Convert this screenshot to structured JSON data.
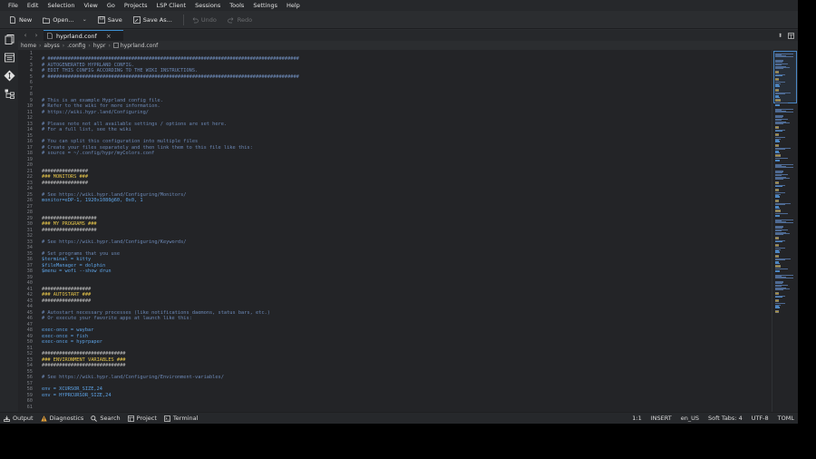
{
  "menu": [
    "File",
    "Edit",
    "Selection",
    "View",
    "Go",
    "Projects",
    "LSP Client",
    "Sessions",
    "Tools",
    "Settings",
    "Help"
  ],
  "toolbar": {
    "new_label": "New",
    "open_label": "Open...",
    "save_label": "Save",
    "save_as_label": "Save As...",
    "undo_label": "Undo",
    "redo_label": "Redo"
  },
  "tab": {
    "label": "hyprland.conf",
    "close": "×"
  },
  "breadcrumb": [
    "home",
    "abyss",
    ".config",
    "hypr",
    "hyprland.conf"
  ],
  "code_lines": [
    {
      "n": "1",
      "t": "",
      "c": "plain"
    },
    {
      "n": "2",
      "t": "# #######################################################################################",
      "c": "cmt"
    },
    {
      "n": "3",
      "t": "# AUTOGENERATED HYPRLAND CONFIG.",
      "c": "cmt"
    },
    {
      "n": "4",
      "t": "# EDIT THIS CONFIG ACCORDING TO THE WIKI INSTRUCTIONS.",
      "c": "cmt"
    },
    {
      "n": "5",
      "t": "# #######################################################################################",
      "c": "cmt"
    },
    {
      "n": "6",
      "t": "",
      "c": "plain"
    },
    {
      "n": "7",
      "t": "",
      "c": "plain"
    },
    {
      "n": "8",
      "t": "",
      "c": "plain"
    },
    {
      "n": "9",
      "t": "# This is an example Hyprland config file.",
      "c": "cmt"
    },
    {
      "n": "10",
      "t": "# Refer to the wiki for more information.",
      "c": "cmt"
    },
    {
      "n": "11",
      "t": "# https://wiki.hypr.land/Configuring/",
      "c": "cmt"
    },
    {
      "n": "12",
      "t": "",
      "c": "plain"
    },
    {
      "n": "13",
      "t": "# Please note not all available settings / options are set here.",
      "c": "cmt"
    },
    {
      "n": "14",
      "t": "# For a full list, see the wiki",
      "c": "cmt"
    },
    {
      "n": "15",
      "t": "",
      "c": "plain"
    },
    {
      "n": "16",
      "t": "# You can split this configuration into multiple files",
      "c": "cmt"
    },
    {
      "n": "17",
      "t": "# Create your files separately and then link them to this file like this:",
      "c": "cmt"
    },
    {
      "n": "18",
      "t": "# source = ~/.config/hypr/myColors.conf",
      "c": "cmt"
    },
    {
      "n": "19",
      "t": "",
      "c": "plain"
    },
    {
      "n": "20",
      "t": "",
      "c": "plain"
    },
    {
      "n": "21",
      "t": "################",
      "c": "hdr"
    },
    {
      "n": "22",
      "t": "### MONITORS ###",
      "c": "hdrk"
    },
    {
      "n": "23",
      "t": "################",
      "c": "hdr"
    },
    {
      "n": "24",
      "t": "",
      "c": "plain"
    },
    {
      "n": "25",
      "t": "# See https://wiki.hypr.land/Configuring/Monitors/",
      "c": "cmt"
    },
    {
      "n": "26",
      "t": "monitor=eDP-1, 1920x1080@60, 0x0, 1",
      "c": "kw"
    },
    {
      "n": "27",
      "t": "",
      "c": "plain"
    },
    {
      "n": "28",
      "t": "",
      "c": "plain"
    },
    {
      "n": "29",
      "t": "###################",
      "c": "hdr"
    },
    {
      "n": "30",
      "t": "### MY PROGRAMS ###",
      "c": "hdrk"
    },
    {
      "n": "31",
      "t": "###################",
      "c": "hdr"
    },
    {
      "n": "32",
      "t": "",
      "c": "plain"
    },
    {
      "n": "33",
      "t": "# See https://wiki.hypr.land/Configuring/Keywords/",
      "c": "cmt"
    },
    {
      "n": "34",
      "t": "",
      "c": "plain"
    },
    {
      "n": "35",
      "t": "# Set programs that you use",
      "c": "cmt"
    },
    {
      "n": "36",
      "t": "$terminal = kitty",
      "c": "kw"
    },
    {
      "n": "37",
      "t": "$fileManager = dolphin",
      "c": "kw"
    },
    {
      "n": "38",
      "t": "$menu = wofi --show drun",
      "c": "kw"
    },
    {
      "n": "39",
      "t": "",
      "c": "plain"
    },
    {
      "n": "40",
      "t": "",
      "c": "plain"
    },
    {
      "n": "41",
      "t": "#################",
      "c": "hdr"
    },
    {
      "n": "42",
      "t": "### AUTOSTART ###",
      "c": "hdrk"
    },
    {
      "n": "43",
      "t": "#################",
      "c": "hdr"
    },
    {
      "n": "44",
      "t": "",
      "c": "plain"
    },
    {
      "n": "45",
      "t": "# Autostart necessary processes (like notifications daemons, status bars, etc.)",
      "c": "cmt"
    },
    {
      "n": "46",
      "t": "# Or execute your favorite apps at launch like this:",
      "c": "cmt"
    },
    {
      "n": "47",
      "t": "",
      "c": "plain"
    },
    {
      "n": "48",
      "t": "exec-once = waybar",
      "c": "kw"
    },
    {
      "n": "49",
      "t": "exec-once = fish",
      "c": "kw"
    },
    {
      "n": "50",
      "t": "exec-once = hyprpaper",
      "c": "kw"
    },
    {
      "n": "51",
      "t": "",
      "c": "plain"
    },
    {
      "n": "52",
      "t": "#############################",
      "c": "hdr"
    },
    {
      "n": "53",
      "t": "### ENVIRONMENT VARIABLES ###",
      "c": "hdrk"
    },
    {
      "n": "54",
      "t": "#############################",
      "c": "hdr"
    },
    {
      "n": "55",
      "t": "",
      "c": "plain"
    },
    {
      "n": "56",
      "t": "# See https://wiki.hypr.land/Configuring/Environment-variables/",
      "c": "cmt"
    },
    {
      "n": "57",
      "t": "",
      "c": "plain"
    },
    {
      "n": "58",
      "t": "env = XCURSOR_SIZE,24",
      "c": "kw"
    },
    {
      "n": "59",
      "t": "env = HYPRCURSOR_SIZE,24",
      "c": "kw"
    },
    {
      "n": "60",
      "t": "",
      "c": "plain"
    },
    {
      "n": "61",
      "t": "",
      "c": "plain"
    }
  ],
  "status": {
    "output": "Output",
    "diagnostics": "Diagnostics",
    "search": "Search",
    "project": "Project",
    "terminal": "Terminal",
    "position": "1:1",
    "mode": "INSERT",
    "language": "en_US",
    "indent": "Soft Tabs: 4",
    "encoding": "UTF-8",
    "filetype": "TOML"
  },
  "colors": {
    "accent": "#3d8fd1",
    "diagnostics_warning": "#e8a33a"
  }
}
